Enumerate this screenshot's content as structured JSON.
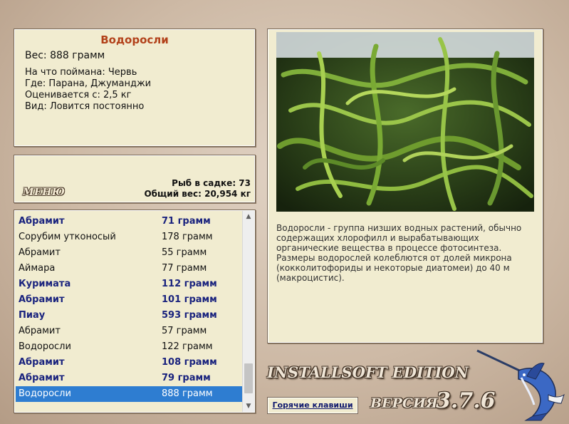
{
  "info": {
    "title": "Водоросли",
    "weight": "Вес: 888 грамм",
    "lines": [
      "На что поймана: Червь",
      "Где: Парана, Джуманджи",
      "Оценивается с: 2,5 кг",
      "Вид: Ловится постоянно"
    ]
  },
  "stats": {
    "menu_label": "МЕНЮ",
    "fish_in_keepnet": "Рыб в садке: 73",
    "total_weight": "Общий вес: 20,954 кг"
  },
  "catch_list": [
    {
      "name": "Абрамит",
      "weight": "71 грамм",
      "bold": true,
      "selected": false
    },
    {
      "name": "Сорубим утконосый",
      "weight": "178 грамм",
      "bold": false,
      "selected": false
    },
    {
      "name": "Абрамит",
      "weight": "55 грамм",
      "bold": false,
      "selected": false
    },
    {
      "name": "Аймара",
      "weight": "77 грамм",
      "bold": false,
      "selected": false
    },
    {
      "name": "Куримата",
      "weight": "112 грамм",
      "bold": true,
      "selected": false
    },
    {
      "name": "Абрамит",
      "weight": "101 грамм",
      "bold": true,
      "selected": false
    },
    {
      "name": "Пиау",
      "weight": "593 грамм",
      "bold": true,
      "selected": false
    },
    {
      "name": "Абрамит",
      "weight": "57 грамм",
      "bold": false,
      "selected": false
    },
    {
      "name": "Водоросли",
      "weight": "122 грамм",
      "bold": false,
      "selected": false
    },
    {
      "name": "Абрамит",
      "weight": "108 грамм",
      "bold": true,
      "selected": false
    },
    {
      "name": "Абрамит",
      "weight": "79 грамм",
      "bold": true,
      "selected": false
    },
    {
      "name": "Водоросли",
      "weight": "888 грамм",
      "bold": false,
      "selected": true
    }
  ],
  "scrollbar": {
    "up_icon": "chevron-up-icon",
    "down_icon": "chevron-down-icon",
    "position": 0.95
  },
  "description": "Водоросли - группа низших водных растений, обычно содержащих хлорофилл и вырабатывающих органические вещества в процессе фотосинтеза. Размеры водорослей колеблются от долей микрона (кокколитофориды и некоторые диатомеи) до 40 м (макроцистис).",
  "footer": {
    "brand": "INSTALLSOFT EDITION",
    "hotkeys_label": "Горячие клавиши",
    "version_label": "ВЕРСИЯ",
    "version_number": "3.7.6"
  },
  "colors": {
    "title": "#b2411a",
    "bold_row": "#1a237e",
    "selection": "#2e7dd1",
    "panel_bg": "#f1ecd0"
  }
}
